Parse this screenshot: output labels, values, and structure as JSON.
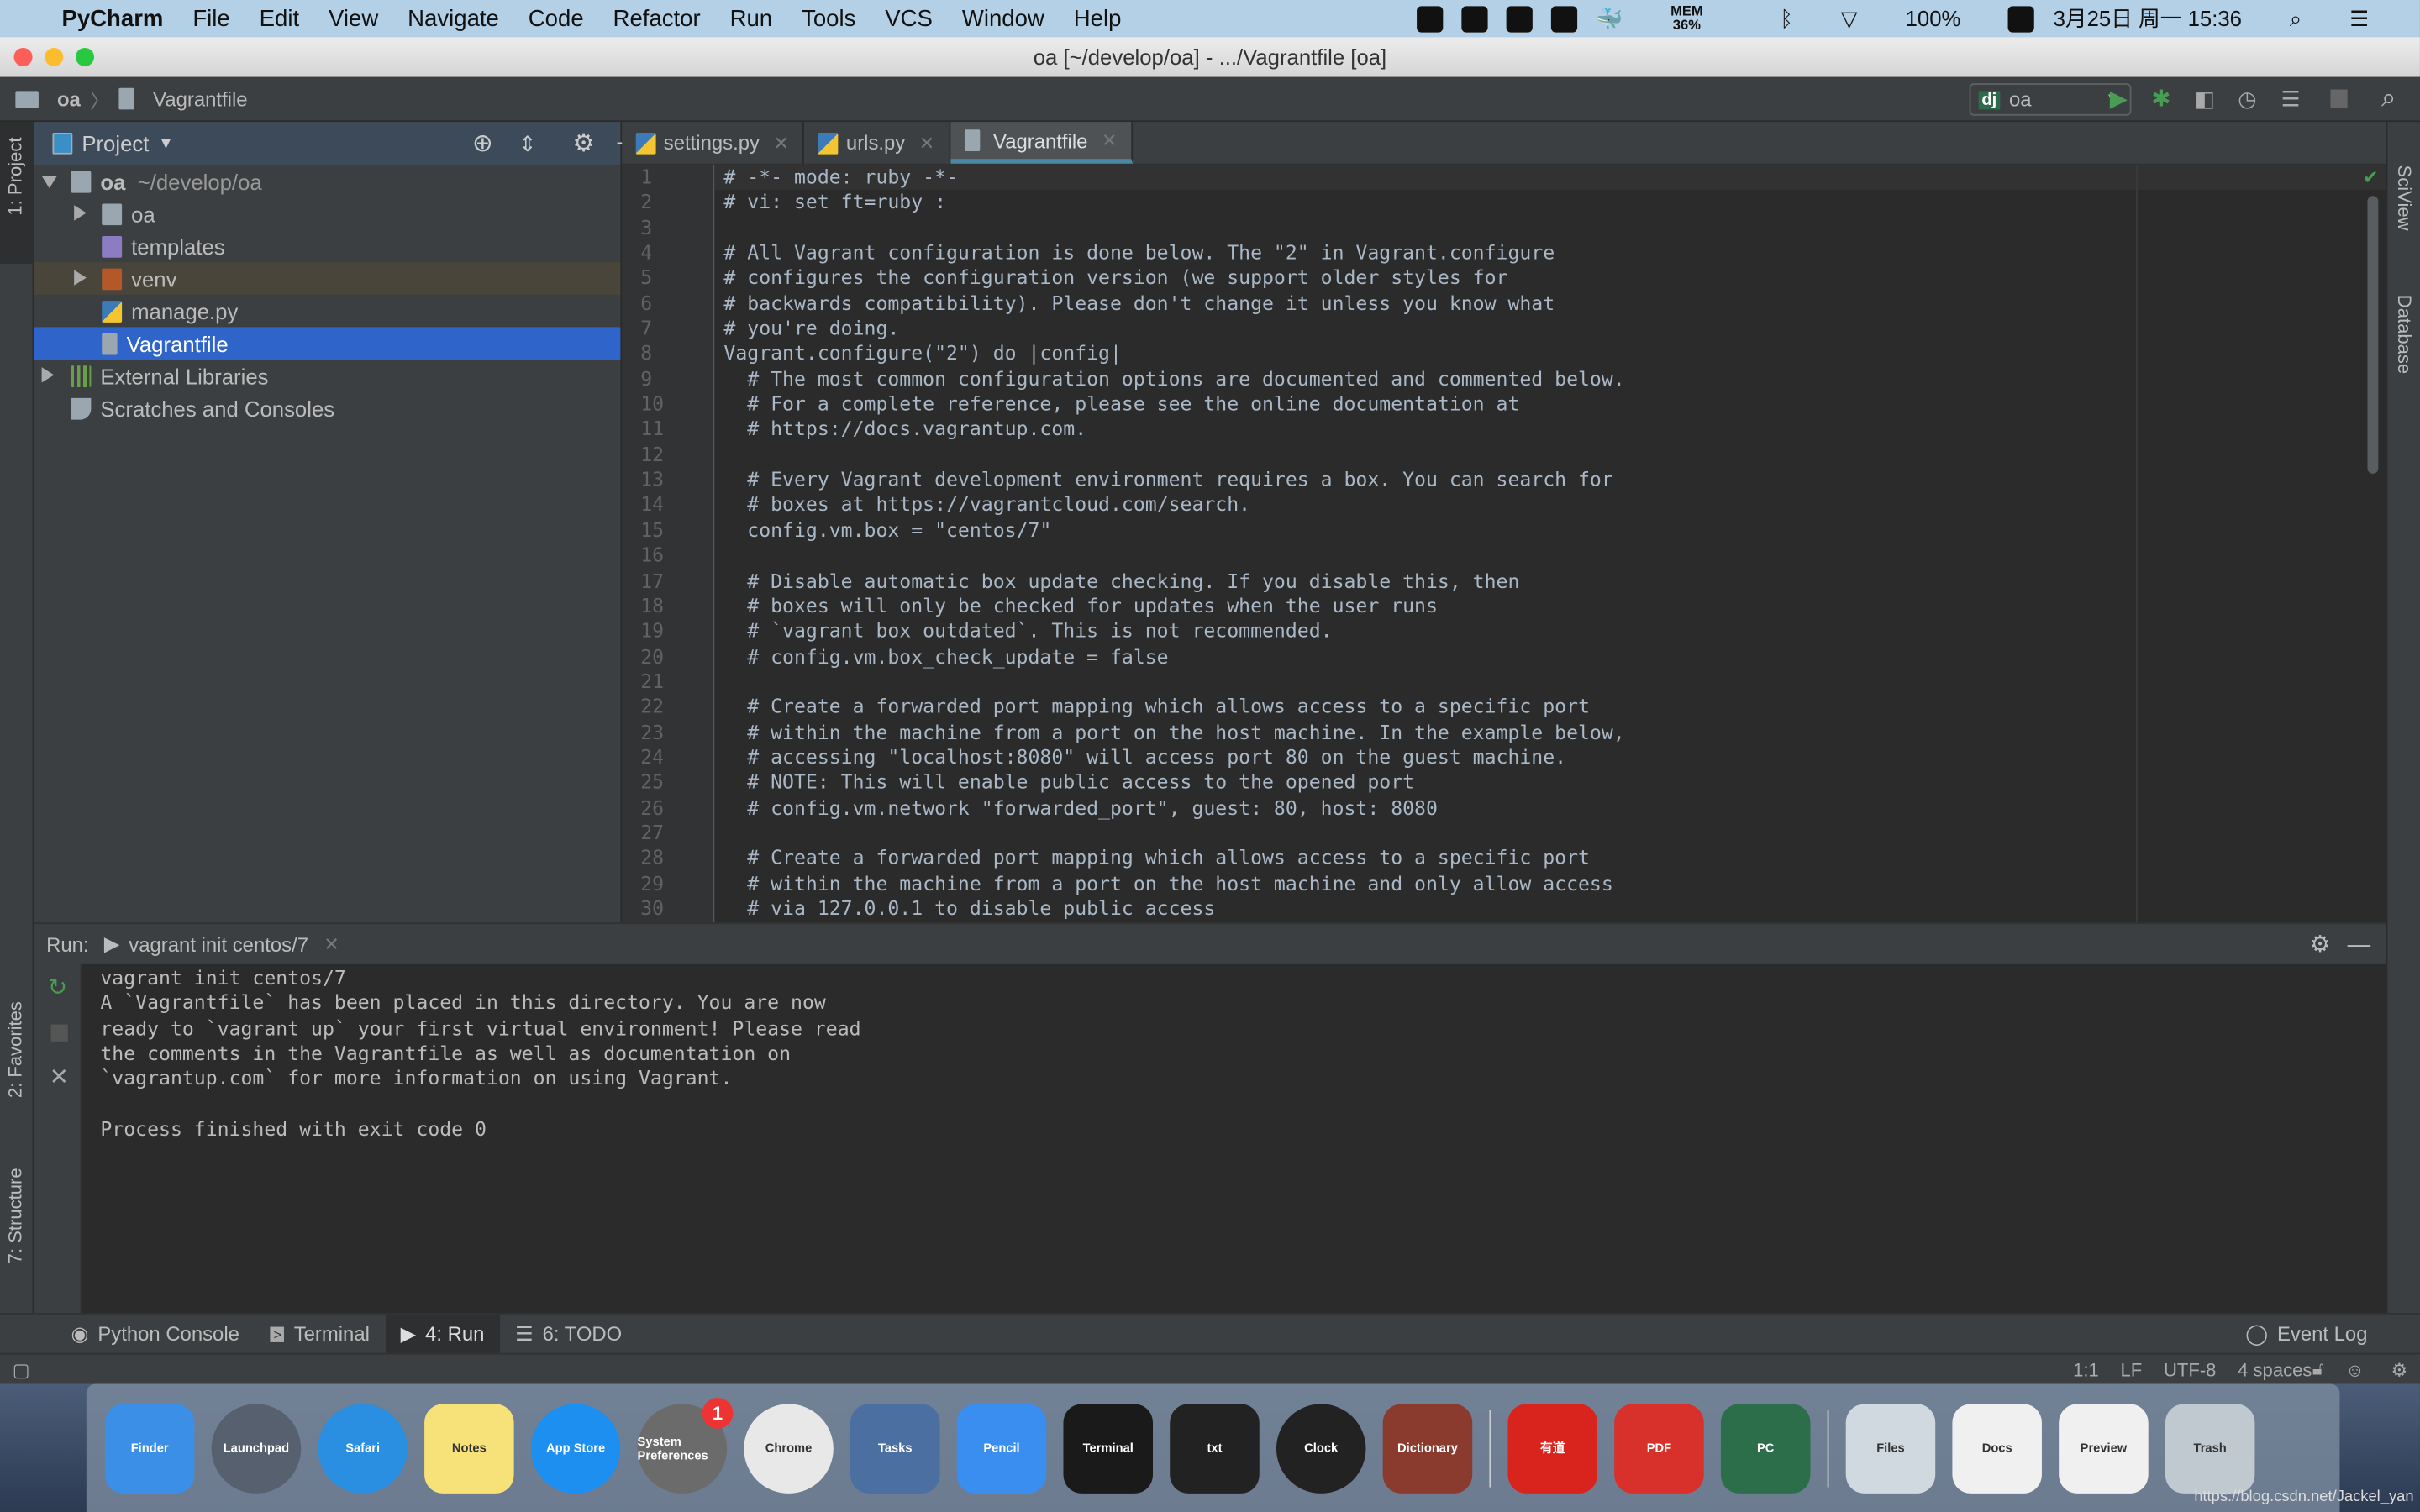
{
  "menubar": {
    "app": "PyCharm",
    "items": [
      "File",
      "Edit",
      "View",
      "Navigate",
      "Code",
      "Refactor",
      "Run",
      "Tools",
      "VCS",
      "Window",
      "Help"
    ],
    "mem_label": "MEM",
    "mem_value": "36%",
    "battery": "100%",
    "datetime": "3月25日 周一  15:36"
  },
  "window": {
    "title": "oa [~/develop/oa] - .../Vagrantfile [oa]"
  },
  "navbar": {
    "crumbs": [
      "oa",
      "Vagrantfile"
    ],
    "run_config": "oa"
  },
  "left_stripe": {
    "project": "1: Project",
    "favorites": "2: Favorites",
    "structure": "7: Structure"
  },
  "right_stripe": {
    "sciview": "SciView",
    "database": "Database"
  },
  "project": {
    "title": "Project",
    "root": "oa",
    "root_path": "~/develop/oa",
    "items": [
      "oa",
      "templates",
      "venv",
      "manage.py",
      "Vagrantfile"
    ],
    "external": "External Libraries",
    "scratches": "Scratches and Consoles"
  },
  "tabs": [
    "settings.py",
    "urls.py",
    "Vagrantfile"
  ],
  "code": [
    "# -*- mode: ruby -*-",
    "# vi: set ft=ruby :",
    "",
    "# All Vagrant configuration is done below. The \"2\" in Vagrant.configure",
    "# configures the configuration version (we support older styles for",
    "# backwards compatibility). Please don't change it unless you know what",
    "# you're doing.",
    "Vagrant.configure(\"2\") do |config|",
    "  # The most common configuration options are documented and commented below.",
    "  # For a complete reference, please see the online documentation at",
    "  # https://docs.vagrantup.com.",
    "",
    "  # Every Vagrant development environment requires a box. You can search for",
    "  # boxes at https://vagrantcloud.com/search.",
    "  config.vm.box = \"centos/7\"",
    "",
    "  # Disable automatic box update checking. If you disable this, then",
    "  # boxes will only be checked for updates when the user runs",
    "  # `vagrant box outdated`. This is not recommended.",
    "  # config.vm.box_check_update = false",
    "",
    "  # Create a forwarded port mapping which allows access to a specific port",
    "  # within the machine from a port on the host machine. In the example below,",
    "  # accessing \"localhost:8080\" will access port 80 on the guest machine.",
    "  # NOTE: This will enable public access to the opened port",
    "  # config.vm.network \"forwarded_port\", guest: 80, host: 8080",
    "",
    "  # Create a forwarded port mapping which allows access to a specific port",
    "  # within the machine from a port on the host machine and only allow access",
    "  # via 127.0.0.1 to disable public access"
  ],
  "run": {
    "label": "Run:",
    "tab": "vagrant init centos/7",
    "output": [
      "vagrant init centos/7",
      "A `Vagrantfile` has been placed in this directory. You are now",
      "ready to `vagrant up` your first virtual environment! Please read",
      "the comments in the Vagrantfile as well as documentation on",
      "`vagrantup.com` for more information on using Vagrant.",
      "",
      "Process finished with exit code 0"
    ]
  },
  "bottom_tools": [
    "Python Console",
    "Terminal",
    "4: Run",
    "6: TODO"
  ],
  "event_log": "Event Log",
  "status": {
    "position": "1:1",
    "line_sep": "LF",
    "encoding": "UTF-8",
    "indent": "4 spaces"
  },
  "dock": {
    "apps": [
      "Finder",
      "Launchpad",
      "Safari",
      "Notes",
      "App Store",
      "System Preferences",
      "Chrome",
      "Tasks",
      "Pencil",
      "Terminal",
      "txt",
      "Clock",
      "Dictionary",
      "有道",
      "PDF",
      "PC",
      "Files",
      "Docs",
      "Preview",
      "Trash"
    ],
    "badge": "1"
  },
  "watermark": "https://blog.csdn.net/Jackel_yan",
  "colors": {
    "selection": "#2f65ca",
    "run_green": "#499c54",
    "editor_bg": "#2b2b2b",
    "panel_bg": "#3c3f41"
  }
}
